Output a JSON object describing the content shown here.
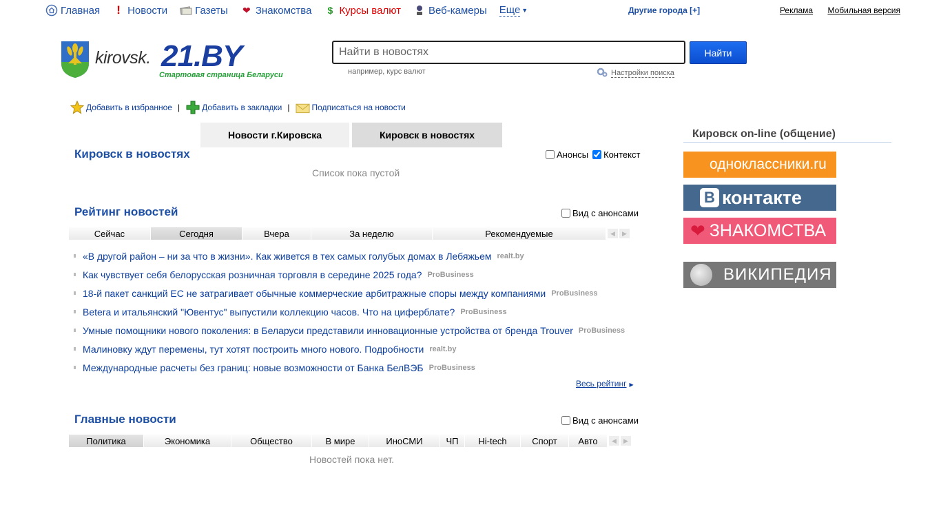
{
  "topnav": {
    "items": [
      {
        "label": "Главная",
        "icon": "home-icon"
      },
      {
        "label": "Новости",
        "icon": "exclamation-icon"
      },
      {
        "label": "Газеты",
        "icon": "newspaper-icon"
      },
      {
        "label": "Знакомства",
        "icon": "heart-icon"
      },
      {
        "label": "Курсы валют",
        "icon": "dollar-icon"
      },
      {
        "label": "Веб-камеры",
        "icon": "webcam-icon"
      }
    ],
    "more": "Еще",
    "other_cities": "Другие города [+]",
    "ads": "Реклама",
    "mobile": "Мобильная версия"
  },
  "header": {
    "city_logo": "kirovsk.",
    "site_logo": "21.BY",
    "slogan": "Стартовая страница Беларуси"
  },
  "search": {
    "placeholder": "Найти в новостях",
    "button": "Найти",
    "hint": "например, курс валют",
    "settings": "Настройки поиска"
  },
  "bookmarks": {
    "favorites": "Добавить в избранное",
    "bookmarks": "Добавить в закладки",
    "subscribe": "Подписаться на новости"
  },
  "tabs": [
    "Новости г.Кировска",
    "Кировск в новостях"
  ],
  "city_news": {
    "title": "Кировск в новостях",
    "check_announce": "Анонсы",
    "check_context": "Контекст",
    "empty": "Список пока пустой"
  },
  "rating": {
    "title": "Рейтинг новостей",
    "check_announce": "Вид с анонсами",
    "filters": [
      "Сейчас",
      "Сегодня",
      "Вчера",
      "За неделю",
      "Рекомендуемые"
    ],
    "active_filter": "Сегодня",
    "items": [
      {
        "text": "«В другой район – ни за что в жизни». Как живется в тех самых голубых домах в Лебяжьем",
        "source": "realt.by"
      },
      {
        "text": "Как чувствует себя белорусская розничная торговля в середине 2025 года?",
        "source": "ProBusiness"
      },
      {
        "text": "18-й пакет санкций ЕС не затрагивает обычные коммерческие арбитражные споры между компаниями",
        "source": "ProBusiness"
      },
      {
        "text": "Betera и итальянский \"Ювентус\" выпустили коллекцию часов. Что на циферблате?",
        "source": "ProBusiness"
      },
      {
        "text": "Умные помощники нового поколения: в Беларуси представили инновационные устройства от бренда Trouver",
        "source": "ProBusiness"
      },
      {
        "text": "Малиновку ждут перемены, тут хотят построить много нового. Подробности",
        "source": "realt.by"
      },
      {
        "text": "Международные расчеты без границ: новые возможности от Банка БелВЭБ",
        "source": "ProBusiness"
      }
    ],
    "all_link": "Весь рейтинг"
  },
  "main_news": {
    "title": "Главные новости",
    "check_announce": "Вид с анонсами",
    "filters": [
      "Политика",
      "Экономика",
      "Общество",
      "В мире",
      "ИноСМИ",
      "ЧП",
      "Hi-tech",
      "Спорт",
      "Авто"
    ],
    "active_filter": "Политика",
    "empty": "Новостей пока нет."
  },
  "online": {
    "title": "Кировск on-line (общение)",
    "ok": "одноклассники.ru",
    "vk_letter": "В",
    "vk": "контакте",
    "dating": "ЗНАКОМСТВА",
    "wiki": "ВИКИПЕДИЯ"
  },
  "colors": {
    "link": "#0b3e9e",
    "title": "#1d4fa5",
    "ok": "#f7931e",
    "vk": "#45688e",
    "dating": "#f05a78",
    "wiki": "#777777"
  }
}
